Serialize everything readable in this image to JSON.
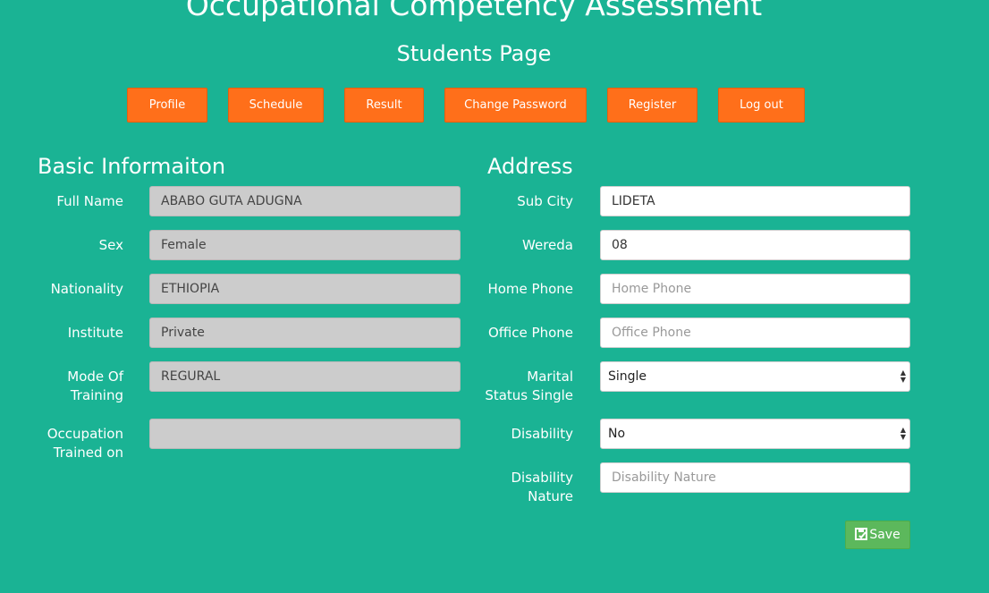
{
  "header": {
    "title": "Occupational Competency Assessment",
    "subtitle": "Students Page"
  },
  "nav": {
    "items": [
      {
        "label": "Profile"
      },
      {
        "label": "Schedule"
      },
      {
        "label": "Result"
      },
      {
        "label": "Change Password"
      },
      {
        "label": "Register"
      },
      {
        "label": "Log out"
      }
    ]
  },
  "basic_info": {
    "title": "Basic Informaiton",
    "fields": [
      {
        "label": "Full Name",
        "value": "ABABO GUTA ADUGNA"
      },
      {
        "label": "Sex",
        "value": "Female"
      },
      {
        "label": "Nationality",
        "value": "ETHIOPIA"
      },
      {
        "label": "Institute",
        "value": "Private"
      },
      {
        "label_line1": "Mode Of",
        "label_line2": "Training",
        "value": "REGURAL"
      },
      {
        "label_line1": "Occupation",
        "label_line2": "Trained on",
        "value": ""
      }
    ]
  },
  "address": {
    "title": "Address",
    "fields": [
      {
        "label": "Sub City",
        "value": "LIDETA",
        "placeholder": ""
      },
      {
        "label": "Wereda",
        "value": "08",
        "placeholder": ""
      },
      {
        "label": "Home Phone",
        "value": "",
        "placeholder": "Home Phone"
      },
      {
        "label": "Office Phone",
        "value": "",
        "placeholder": "Office Phone"
      },
      {
        "label_line1": "Marital",
        "label_line2": "Status Single",
        "value": "Single"
      },
      {
        "label": "Disability",
        "value": "No"
      },
      {
        "label_line1": "Disability",
        "label_line2": "Nature",
        "value": "",
        "placeholder": "Disability Nature"
      }
    ]
  },
  "save_button": {
    "label": "Save",
    "icon": "save-icon"
  },
  "colors": {
    "background": "#1ab394",
    "nav_button": "#ff6f1a",
    "save_button": "#5cb85c",
    "readonly_field": "#cccccc"
  }
}
